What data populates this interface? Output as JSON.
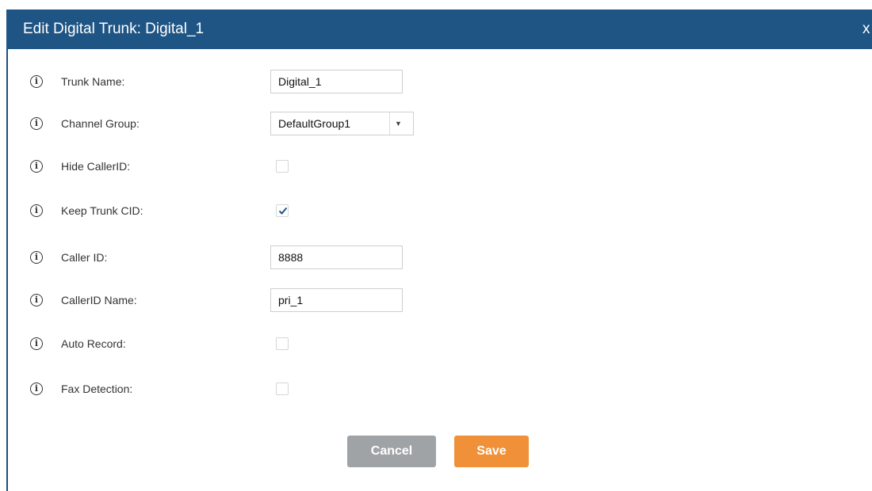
{
  "dialog": {
    "title": "Edit Digital Trunk: Digital_1",
    "close_label": "x"
  },
  "info_icon_glyph": "i",
  "fields": {
    "trunk_name": {
      "label": "Trunk Name:",
      "value": "Digital_1"
    },
    "channel_group": {
      "label": "Channel Group:",
      "selected": "DefaultGroup1",
      "arrow": "▼"
    },
    "hide_callerid": {
      "label": "Hide CallerID:",
      "checked": false
    },
    "keep_trunk_cid": {
      "label": "Keep Trunk CID:",
      "checked": true
    },
    "caller_id": {
      "label": "Caller ID:",
      "value": "8888"
    },
    "callerid_name": {
      "label": "CallerID Name:",
      "value": "pri_1"
    },
    "auto_record": {
      "label": "Auto Record:",
      "checked": false
    },
    "fax_detection": {
      "label": "Fax Detection:",
      "checked": false
    }
  },
  "buttons": {
    "cancel": "Cancel",
    "save": "Save"
  },
  "colors": {
    "titlebar": "#1f5585",
    "save_button": "#f0913a",
    "cancel_button": "#a0a3a6",
    "checkmark": "#1f5585"
  },
  "icons": {
    "info": "info-circle-icon",
    "check": "checkmark-icon",
    "dropdown": "caret-down-icon",
    "close": "close-icon"
  }
}
